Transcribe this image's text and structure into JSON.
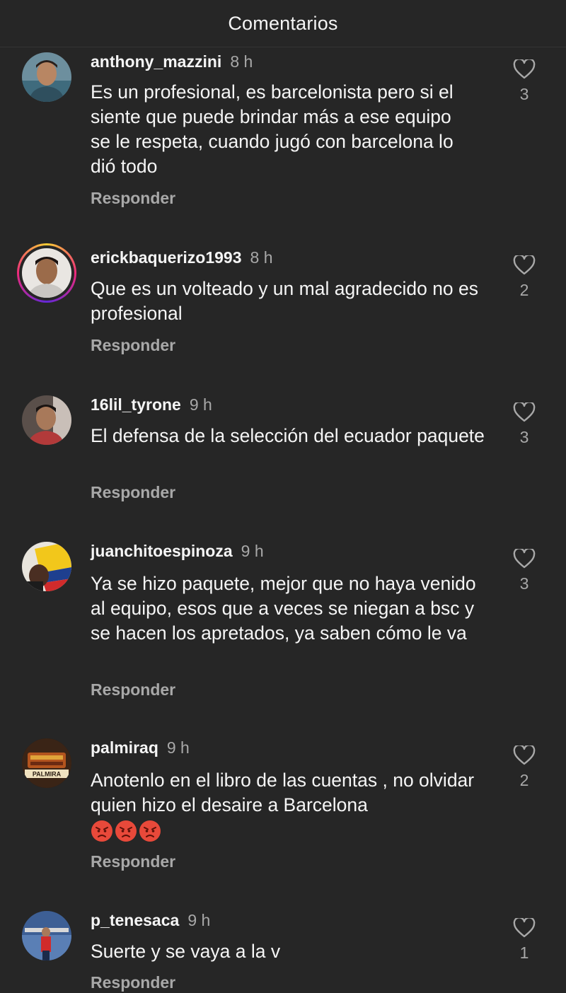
{
  "header": {
    "title": "Comentarios"
  },
  "reply_label": "Responder",
  "comments": [
    {
      "username": "anthony_mazzini",
      "time": "8 h",
      "text": "Es un profesional, es barcelonista pero si el siente que puede brindar más a ese equipo se le respeta, cuando jugó con barcelona lo dió todo",
      "likes": "3",
      "avatar_icon": "profile-photo-man-icon"
    },
    {
      "username": "erickbaquerizo1993",
      "time": "8 h",
      "text": "Que es un volteado y un mal agradecido no es profesional",
      "likes": "2",
      "avatar_icon": "profile-photo-man-icon",
      "has_story": true
    },
    {
      "username": "16lil_tyrone",
      "time": "9 h",
      "text": "El defensa de la selección del ecuador paquete",
      "likes": "3",
      "avatar_icon": "profile-photo-man-icon"
    },
    {
      "username": "juanchitoespinoza",
      "time": "9 h",
      "text": "Ya se hizo paquete, mejor que no haya venido al equipo, esos que a veces se niegan a bsc y se hacen los apretados, ya saben cómo le va",
      "likes": "3",
      "avatar_icon": "profile-photo-flag-icon"
    },
    {
      "username": "palmiraq",
      "time": "9 h",
      "text": "Anotenlo en el libro de las cuentas , no olvidar quien hizo el desaire a Barcelona",
      "emojis": [
        "angry-face-emoji",
        "angry-face-emoji",
        "angry-face-emoji"
      ],
      "likes": "2",
      "avatar_icon": "palmira-logo-icon",
      "avatar_logo_text": "PALMIRA"
    },
    {
      "username": "p_tenesaca",
      "time": "9 h",
      "text": "Suerte y se vaya a la v",
      "likes": "1",
      "avatar_icon": "profile-photo-outdoor-icon"
    }
  ],
  "colors": {
    "background": "#262626",
    "primary_text": "#f5f5f5",
    "secondary_text": "#a8a8a8"
  }
}
